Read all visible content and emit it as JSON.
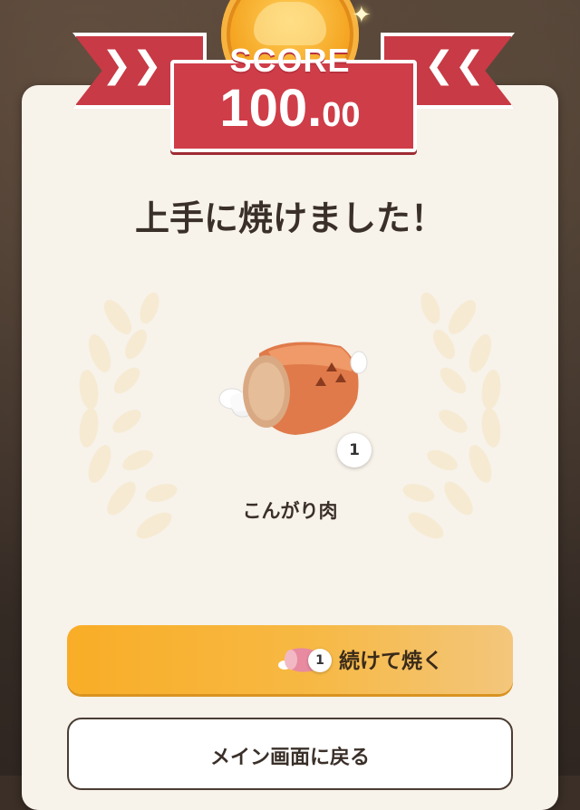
{
  "score": {
    "label": "SCORE",
    "integer": "100.",
    "decimal": "00"
  },
  "result": {
    "title": "上手に焼けました！"
  },
  "reward": {
    "icon": "roasted-meat-icon",
    "quantity": "1",
    "name": "こんがり肉"
  },
  "buttons": {
    "continue": {
      "label": "続けて焼く",
      "icon": "raw-meat-icon",
      "badge": "1"
    },
    "main_menu": {
      "label": "メイン画面に戻る"
    }
  },
  "colors": {
    "ribbon": "#cf3d48",
    "medal": "#f5a623",
    "card": "#f7f2ea",
    "continue_button": "#f9ad27",
    "text": "#3a3029"
  }
}
